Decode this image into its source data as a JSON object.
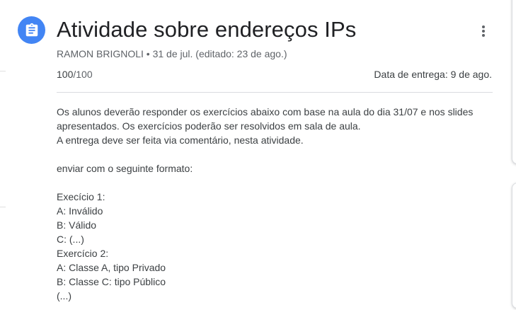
{
  "assignment": {
    "icon": "assignment-icon",
    "accent_color": "#4285f4",
    "title": "Atividade sobre endereços IPs",
    "author": "RAMON BRIGNOLI",
    "meta_rest": " • 31 de jul. (editado: 23 de ago.)",
    "points_earned": "100",
    "points_max": "/100",
    "due_label": "Data de entrega: 9 de ago.",
    "more_icon": "more-vert-icon"
  },
  "description": {
    "lines": [
      "Os alunos deverão responder os exercícios abaixo com base na aula do dia 31/07 e nos slides",
      "apresentados. Os exercícios poderão ser resolvidos em sala de aula.",
      "A entrega deve ser feita via comentário, nesta atividade.",
      "",
      "enviar com o seguinte formato:",
      "",
      "Execício 1:",
      "A: Inválido",
      "B: Válido",
      "C: (...)",
      "Exercício 2:",
      "A: Classe A, tipo Privado",
      "B: Classe C: tipo Público",
      "(...)"
    ]
  }
}
